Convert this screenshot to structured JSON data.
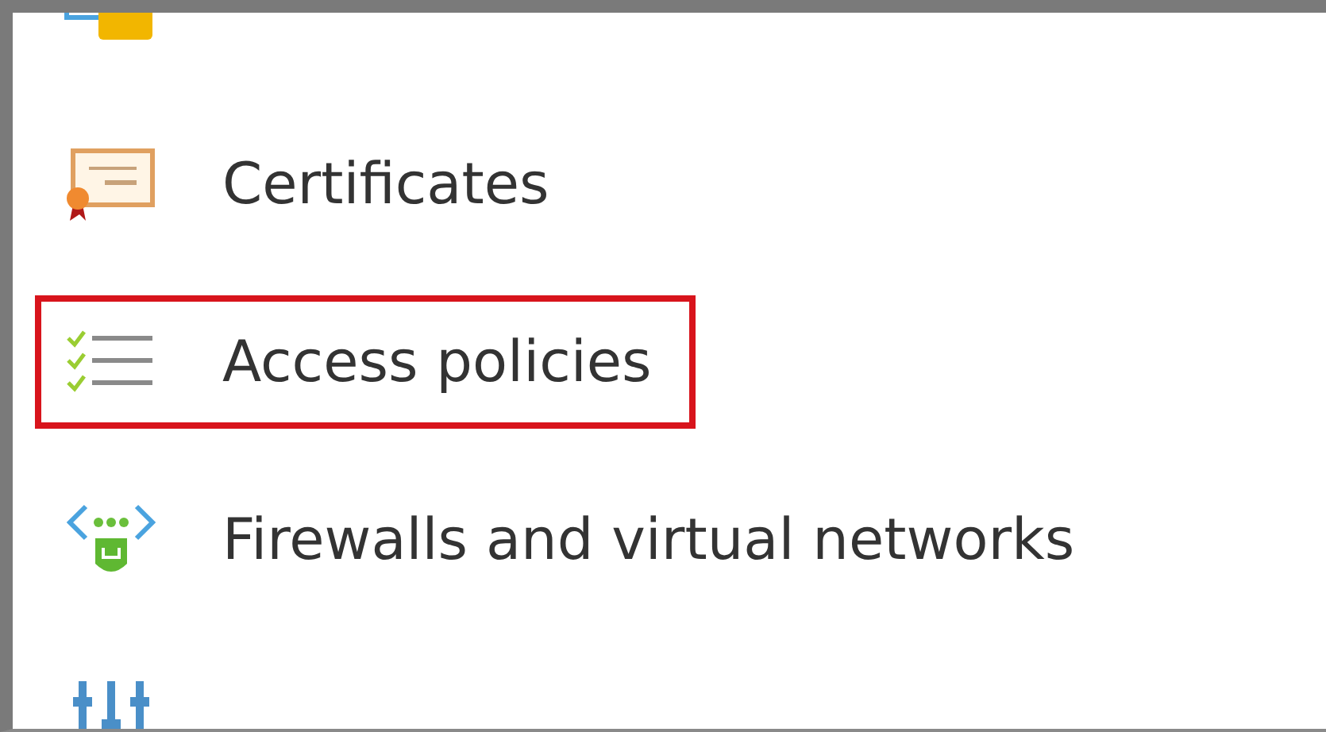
{
  "menu": {
    "items": [
      {
        "kind": "secret",
        "highlighted": false
      },
      {
        "label": "Certificates",
        "kind": "certificate",
        "highlighted": false
      },
      {
        "label": "Access policies",
        "kind": "policy",
        "highlighted": true
      },
      {
        "label": "Firewalls and virtual networks",
        "kind": "firewall",
        "highlighted": false
      },
      {
        "kind": "properties",
        "highlighted": false
      }
    ]
  }
}
